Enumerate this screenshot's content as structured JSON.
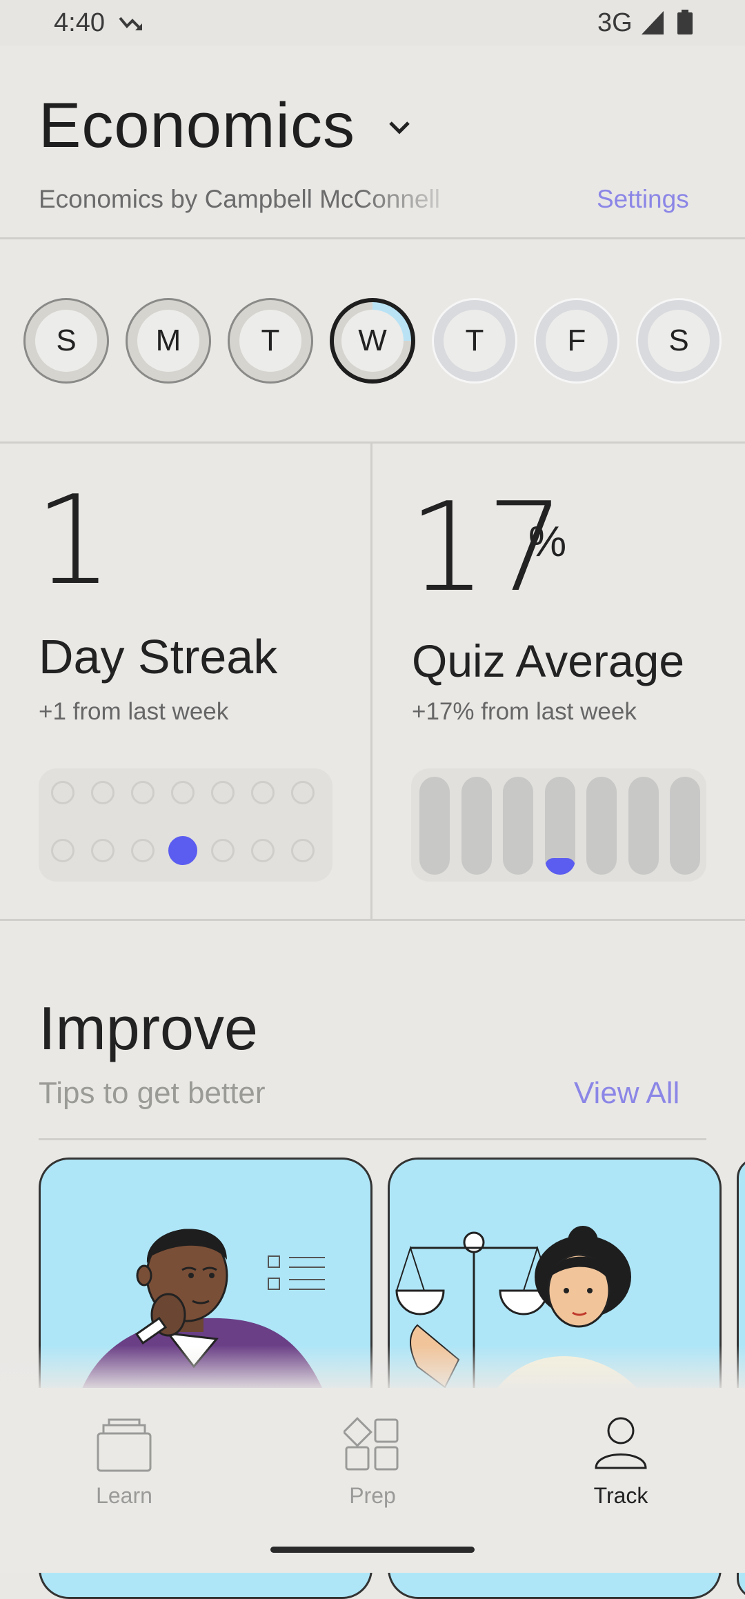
{
  "status_bar": {
    "time": "4:40",
    "network": "3G",
    "icons": [
      "trending-icon",
      "signal-icon",
      "battery-icon"
    ]
  },
  "header": {
    "title": "Economics",
    "subtitle": "Economics by Campbell McConnell",
    "settings_label": "Settings"
  },
  "week": {
    "days": [
      {
        "letter": "S",
        "state": "past"
      },
      {
        "letter": "M",
        "state": "past"
      },
      {
        "letter": "T",
        "state": "past"
      },
      {
        "letter": "W",
        "state": "today",
        "progress": 0.25
      },
      {
        "letter": "T",
        "state": "future"
      },
      {
        "letter": "F",
        "state": "future"
      },
      {
        "letter": "S",
        "state": "future"
      }
    ]
  },
  "streak": {
    "value": "1",
    "label": "Day Streak",
    "sub": "+1 from last week",
    "grid_rows": [
      [
        0,
        0,
        0,
        0,
        0,
        0,
        0
      ],
      [
        0,
        0,
        0,
        1,
        0,
        0,
        0
      ]
    ]
  },
  "quiz": {
    "value": "17",
    "unit": "%",
    "label": "Quiz Average",
    "sub": "+17% from last week",
    "daily_levels": [
      0,
      0,
      0,
      0.17,
      0,
      0,
      0
    ]
  },
  "improve": {
    "title": "Improve",
    "subtitle": "Tips to get better",
    "view_all": "View All"
  },
  "nav": {
    "items": [
      {
        "label": "Learn",
        "icon": "folder-icon",
        "active": false
      },
      {
        "label": "Prep",
        "icon": "grid-icon",
        "active": false
      },
      {
        "label": "Track",
        "icon": "person-icon",
        "active": true
      }
    ]
  },
  "colors": {
    "accent": "#5b5cf0",
    "link": "#8b86e6",
    "card_bg": "#aee6f8"
  }
}
